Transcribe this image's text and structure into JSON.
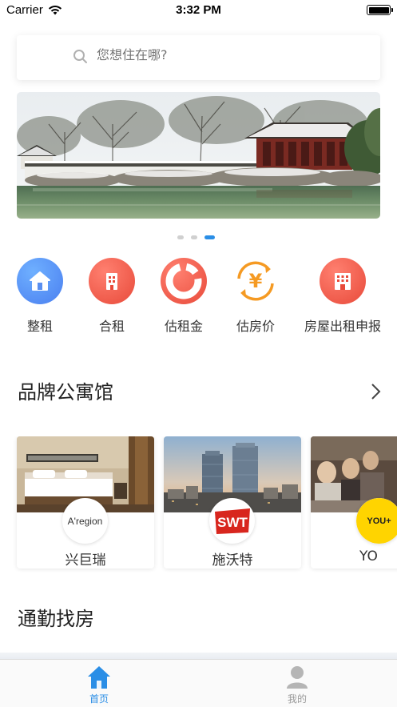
{
  "status_bar": {
    "carrier": "Carrier",
    "time": "3:32 PM"
  },
  "search": {
    "placeholder": "您想住在哪?"
  },
  "banner": {
    "pages": 3,
    "active_page": 3
  },
  "categories": [
    {
      "label": "整租",
      "icon": "house-icon",
      "color": "#4a8ef0"
    },
    {
      "label": "合租",
      "icon": "building-icon",
      "color": "#ef5a4a"
    },
    {
      "label": "估租金",
      "icon": "ring-chart-icon",
      "color": "#ef5a4a"
    },
    {
      "label": "估房价",
      "icon": "yuan-refresh-icon",
      "color": "#f59a23"
    },
    {
      "label": "房屋出租申报",
      "icon": "apartment-icon",
      "color": "#ef5a4a"
    }
  ],
  "brand_section": {
    "title": "品牌公寓馆"
  },
  "brands": [
    {
      "name": "兴巨瑞",
      "logo_text": "A'region"
    },
    {
      "name": "施沃特",
      "logo_text": "SWT"
    },
    {
      "name": "YO",
      "logo_text": "YOU+"
    }
  ],
  "commute_section": {
    "title": "通勤找房"
  },
  "tabbar": {
    "home": {
      "label": "首页",
      "color": "#2a8ee6"
    },
    "mine": {
      "label": "我的",
      "color": "#999999"
    }
  }
}
